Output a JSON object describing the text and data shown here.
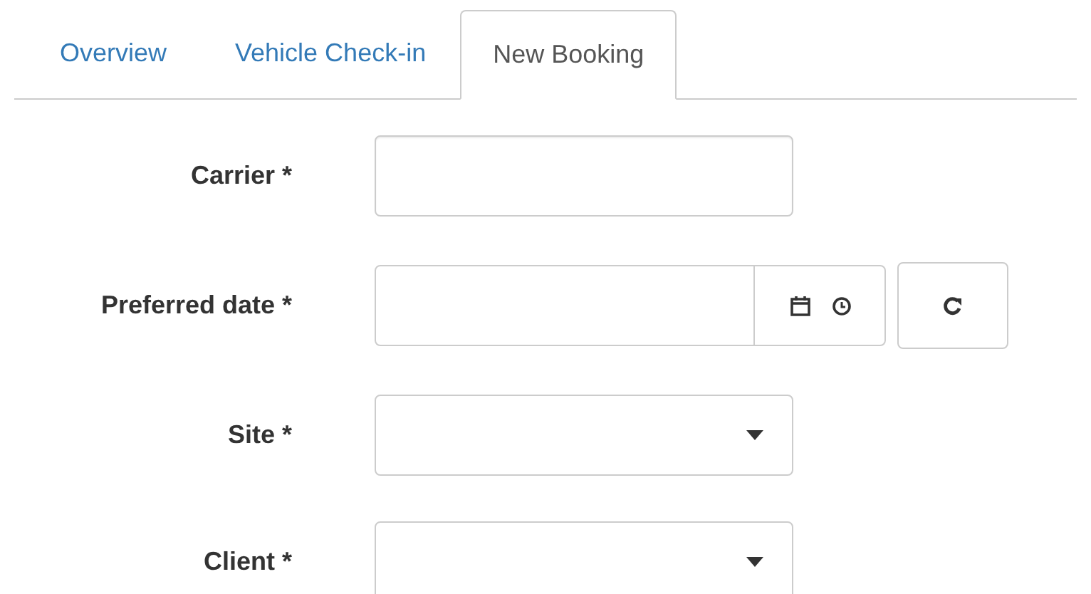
{
  "tabs": [
    {
      "label": "Overview",
      "selected": false
    },
    {
      "label": "Vehicle Check-in",
      "selected": false
    },
    {
      "label": "New Booking",
      "selected": true
    }
  ],
  "form": {
    "fields": [
      {
        "label": "Carrier *",
        "kind": "text"
      },
      {
        "label": "Preferred date *",
        "kind": "datetime"
      },
      {
        "label": "Site *",
        "kind": "select"
      },
      {
        "label": "Client *",
        "kind": "select"
      }
    ]
  }
}
